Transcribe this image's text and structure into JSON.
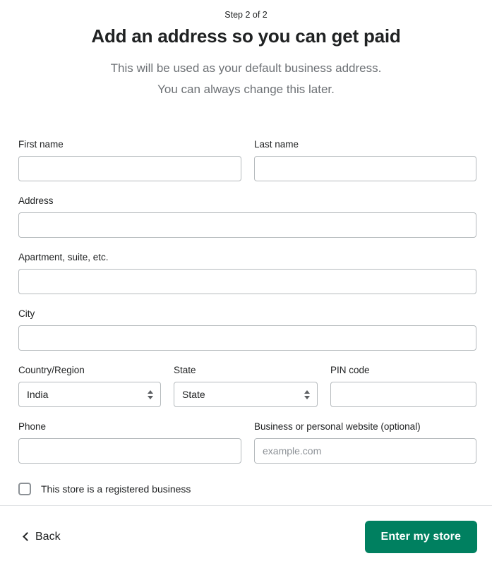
{
  "header": {
    "step_label": "Step 2 of 2",
    "title": "Add an address so you can get paid",
    "subtitle_line1": "This will be used as your default business address.",
    "subtitle_line2": "You can always change this later."
  },
  "form": {
    "first_name": {
      "label": "First name",
      "value": "",
      "placeholder": ""
    },
    "last_name": {
      "label": "Last name",
      "value": "",
      "placeholder": ""
    },
    "address": {
      "label": "Address",
      "value": "",
      "placeholder": ""
    },
    "apartment": {
      "label": "Apartment, suite, etc.",
      "value": "",
      "placeholder": ""
    },
    "city": {
      "label": "City",
      "value": "",
      "placeholder": ""
    },
    "country": {
      "label": "Country/Region",
      "value": "India"
    },
    "state": {
      "label": "State",
      "value": "State"
    },
    "pin_code": {
      "label": "PIN code",
      "value": "",
      "placeholder": ""
    },
    "phone": {
      "label": "Phone",
      "value": "",
      "placeholder": ""
    },
    "website": {
      "label": "Business or personal website (optional)",
      "value": "",
      "placeholder": "example.com"
    },
    "registered_business": {
      "label": "This store is a registered business",
      "checked": false
    }
  },
  "footer": {
    "back_label": "Back",
    "submit_label": "Enter my store"
  },
  "colors": {
    "primary": "#008060",
    "text": "#202223",
    "muted": "#6d7175",
    "border": "#b5babd",
    "divider": "#e1e3e5"
  },
  "icons": {
    "back": "chevron-left-icon",
    "select": "chevron-up-down-icon",
    "checkbox": "checkbox-unchecked-icon"
  }
}
